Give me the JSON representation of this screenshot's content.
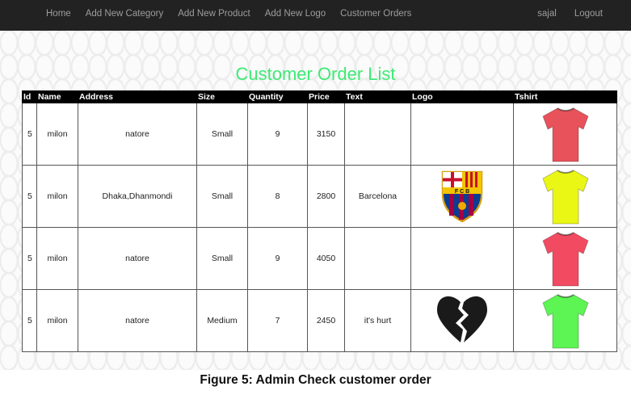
{
  "nav": {
    "items": [
      "Home",
      "Add New Category",
      "Add New Product",
      "Add New Logo",
      "Customer Orders"
    ],
    "user": "sajal",
    "logout": "Logout"
  },
  "page": {
    "title": "Customer Order List",
    "caption": "Figure 5: Admin Check customer order"
  },
  "table": {
    "headers": [
      "Id",
      "Name",
      "Address",
      "Size",
      "Quantity",
      "Price",
      "Text",
      "Logo",
      "Tshirt"
    ],
    "rows": [
      {
        "id": "5",
        "name": "milon",
        "address": "natore",
        "size": "Small",
        "quantity": "9",
        "price": "3150",
        "text": "",
        "logo": "none",
        "tshirt_color": "#e8525a"
      },
      {
        "id": "5",
        "name": "milon",
        "address": "Dhaka,Dhanmondi",
        "size": "Small",
        "quantity": "8",
        "price": "2800",
        "text": "Barcelona",
        "logo": "fcb-crest-icon",
        "tshirt_color": "#eaf714"
      },
      {
        "id": "5",
        "name": "milon",
        "address": "natore",
        "size": "Small",
        "quantity": "9",
        "price": "4050",
        "text": "",
        "logo": "none",
        "tshirt_color": "#f24b61"
      },
      {
        "id": "5",
        "name": "milon",
        "address": "natore",
        "size": "Medium",
        "quantity": "7",
        "price": "2450",
        "text": "it's hurt",
        "logo": "broken-heart-icon",
        "tshirt_color": "#5cf553"
      }
    ]
  }
}
